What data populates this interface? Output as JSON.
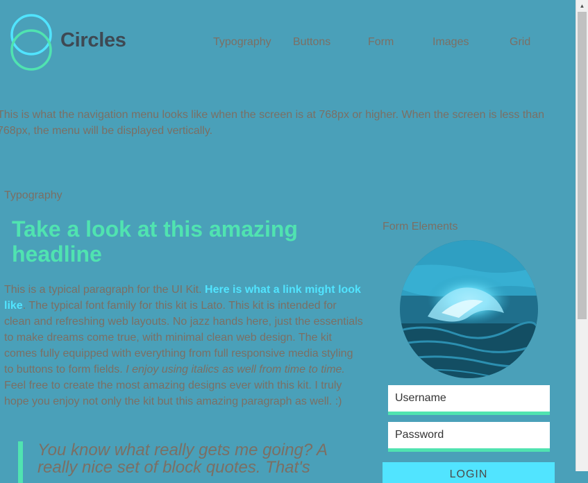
{
  "brand": {
    "name": "Circles"
  },
  "nav": {
    "items": [
      {
        "label": "Typography"
      },
      {
        "label": "Buttons"
      },
      {
        "label": "Form"
      },
      {
        "label": "Images"
      },
      {
        "label": "Grid"
      }
    ]
  },
  "intro": {
    "text": "This is what the navigation menu looks like when the screen is at 768px or higher. When the screen is less than 768px, the menu will be displayed vertically."
  },
  "typography": {
    "section_label": "Typography",
    "headline": "Take a look at this amazing headline",
    "para_start": "This is a typical paragraph for the UI Kit. ",
    "link_text": "Here is what a link might look like",
    "para_middle": ". The typical font family for this kit is Lato. This kit is intended for clean and refreshing web layouts. No jazz hands here, just the essentials to make dreams come true, with minimal clean web design. The kit comes fully equipped with everything from full responsive media styling to buttons to form fields. ",
    "italic_text": "I enjoy using italics as well from time to time.",
    "para_end": " Feel free to create the most amazing designs ever with this kit. I truly hope you enjoy not only the kit but this amazing paragraph as well. :)",
    "blockquote": "You know what really gets me going? A really nice set of block quotes. That's"
  },
  "form": {
    "section_label": "Form Elements",
    "username_placeholder": "Username",
    "password_placeholder": "Password",
    "login_label": "LOGIN"
  },
  "colors": {
    "background": "#4aa0b9",
    "accent_green": "#50e3b0",
    "accent_blue": "#51e4ff",
    "text": "#7b6f64",
    "brand_text": "#3e4953"
  },
  "icons": {
    "logo": "circles-logo-icon",
    "scroll_up": "scroll-up-arrow-icon"
  }
}
